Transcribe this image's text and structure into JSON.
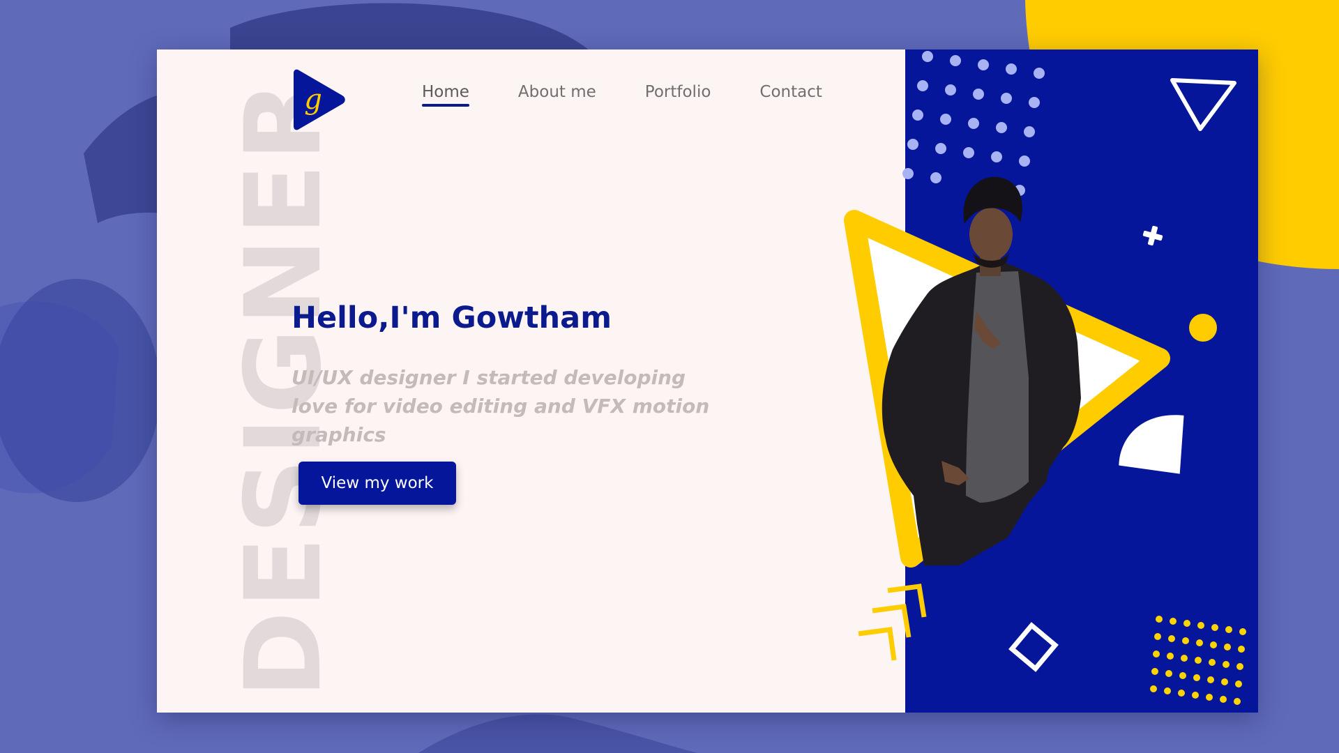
{
  "background_word": "DESIGNER",
  "logo": {
    "letter": "g"
  },
  "nav": {
    "items": [
      {
        "label": "Home",
        "active": true
      },
      {
        "label": "About me",
        "active": false
      },
      {
        "label": "Portfolio",
        "active": false
      },
      {
        "label": "Contact",
        "active": false
      }
    ]
  },
  "hero": {
    "title": "Hello,I'm Gowtham",
    "subtitle": "UI/UX designer I started developing love for video editing and VFX motion graphics",
    "cta_label": "View my work"
  },
  "colors": {
    "primary_blue": "#06169a",
    "accent_yellow": "#ffcc00",
    "page_background": "#fdf4f4",
    "outer_background": "#5f6ab9"
  },
  "icons": [
    "play-logo-icon",
    "triangle-outline-icon",
    "plus-icon",
    "circle-dot-icon",
    "quarter-circle-icon",
    "diamond-outline-icon",
    "chevron-up-icon",
    "dot-pattern-icon"
  ]
}
